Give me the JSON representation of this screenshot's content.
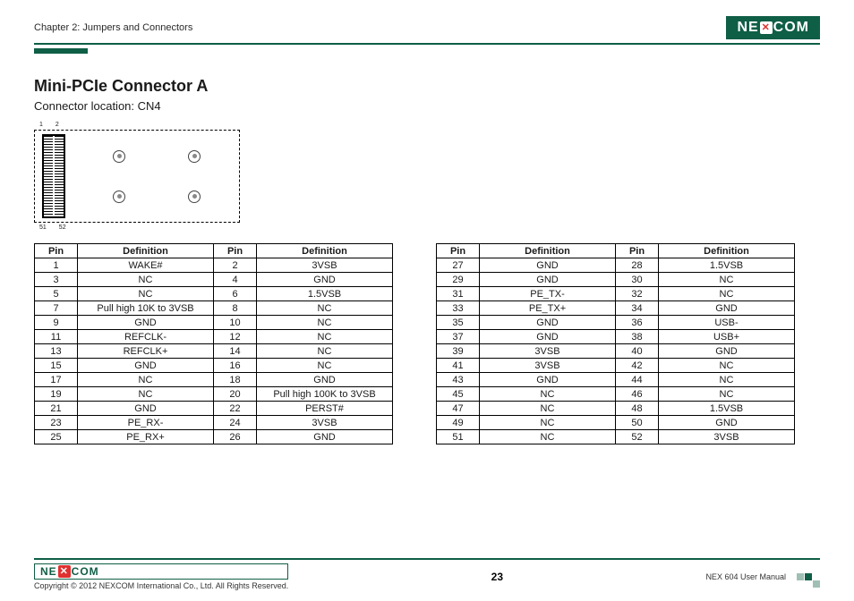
{
  "header": {
    "chapter": "Chapter 2: Jumpers and Connectors",
    "logo_text_a": "NE",
    "logo_text_b": "COM"
  },
  "section": {
    "title": "Mini-PCIe Connector A",
    "subtitle": "Connector location: CN4"
  },
  "diagram": {
    "pin_tl": "1",
    "pin_tr": "2",
    "pin_bl": "51",
    "pin_br": "52"
  },
  "table_headers": {
    "pin": "Pin",
    "def": "Definition"
  },
  "table1": [
    {
      "p1": "1",
      "d1": "WAKE#",
      "p2": "2",
      "d2": "3VSB"
    },
    {
      "p1": "3",
      "d1": "NC",
      "p2": "4",
      "d2": "GND"
    },
    {
      "p1": "5",
      "d1": "NC",
      "p2": "6",
      "d2": "1.5VSB"
    },
    {
      "p1": "7",
      "d1": "Pull high 10K to 3VSB",
      "p2": "8",
      "d2": "NC"
    },
    {
      "p1": "9",
      "d1": "GND",
      "p2": "10",
      "d2": "NC"
    },
    {
      "p1": "11",
      "d1": "REFCLK-",
      "p2": "12",
      "d2": "NC"
    },
    {
      "p1": "13",
      "d1": "REFCLK+",
      "p2": "14",
      "d2": "NC"
    },
    {
      "p1": "15",
      "d1": "GND",
      "p2": "16",
      "d2": "NC"
    },
    {
      "p1": "17",
      "d1": "NC",
      "p2": "18",
      "d2": "GND"
    },
    {
      "p1": "19",
      "d1": "NC",
      "p2": "20",
      "d2": "Pull high 100K to 3VSB"
    },
    {
      "p1": "21",
      "d1": "GND",
      "p2": "22",
      "d2": "PERST#"
    },
    {
      "p1": "23",
      "d1": "PE_RX-",
      "p2": "24",
      "d2": "3VSB"
    },
    {
      "p1": "25",
      "d1": "PE_RX+",
      "p2": "26",
      "d2": "GND"
    }
  ],
  "table2": [
    {
      "p1": "27",
      "d1": "GND",
      "p2": "28",
      "d2": "1.5VSB"
    },
    {
      "p1": "29",
      "d1": "GND",
      "p2": "30",
      "d2": "NC"
    },
    {
      "p1": "31",
      "d1": "PE_TX-",
      "p2": "32",
      "d2": "NC"
    },
    {
      "p1": "33",
      "d1": "PE_TX+",
      "p2": "34",
      "d2": "GND"
    },
    {
      "p1": "35",
      "d1": "GND",
      "p2": "36",
      "d2": "USB-"
    },
    {
      "p1": "37",
      "d1": "GND",
      "p2": "38",
      "d2": "USB+"
    },
    {
      "p1": "39",
      "d1": "3VSB",
      "p2": "40",
      "d2": "GND"
    },
    {
      "p1": "41",
      "d1": "3VSB",
      "p2": "42",
      "d2": "NC"
    },
    {
      "p1": "43",
      "d1": "GND",
      "p2": "44",
      "d2": "NC"
    },
    {
      "p1": "45",
      "d1": "NC",
      "p2": "46",
      "d2": "NC"
    },
    {
      "p1": "47",
      "d1": "NC",
      "p2": "48",
      "d2": "1.5VSB"
    },
    {
      "p1": "49",
      "d1": "NC",
      "p2": "50",
      "d2": "GND"
    },
    {
      "p1": "51",
      "d1": "NC",
      "p2": "52",
      "d2": "3VSB"
    }
  ],
  "footer": {
    "copyright": "Copyright © 2012 NEXCOM International Co., Ltd. All Rights Reserved.",
    "page": "23",
    "manual": "NEX 604 User Manual"
  }
}
